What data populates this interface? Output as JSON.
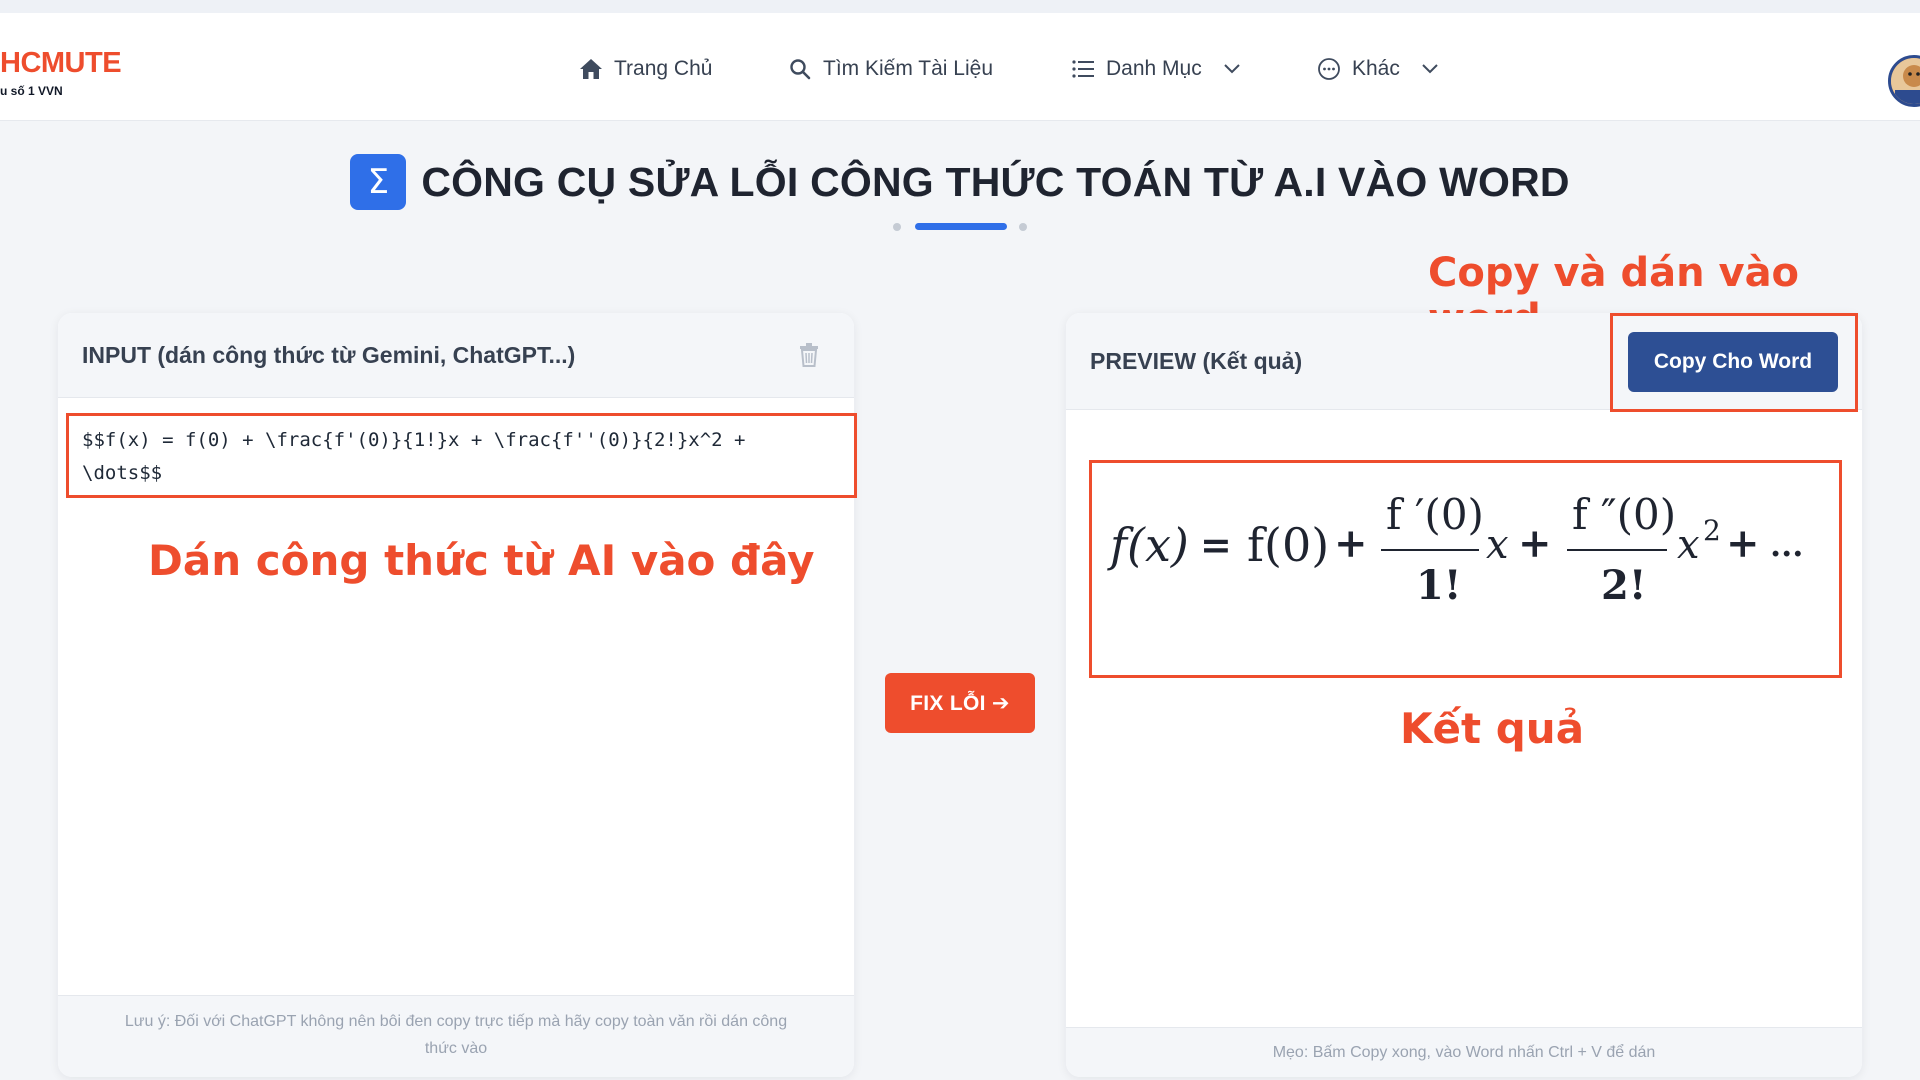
{
  "nav": {
    "logo_main": "HCMUTE",
    "logo_sub": "u số 1 VVN",
    "items": [
      {
        "label": "Trang Chủ",
        "icon": "home-icon"
      },
      {
        "label": "Tìm Kiếm Tài Liệu",
        "icon": "search-icon"
      },
      {
        "label": "Danh Mục",
        "icon": "list-icon"
      },
      {
        "label": "Khác",
        "icon": "more-icon"
      }
    ]
  },
  "page": {
    "title": "CÔNG CỤ SỬA LỖI CÔNG THỨC TOÁN TỪ A.I VÀO WORD",
    "title_icon": "Σ"
  },
  "annotations": {
    "copy_hint": "Copy và dán vào word",
    "paste_hint": "Dán công thức từ AI vào đây",
    "result_hint": "Kết quả"
  },
  "input_panel": {
    "header": "INPUT (dán công thức từ Gemini, ChatGPT...)",
    "trash_icon": "trash-icon",
    "value_line1": "$$f(x) = f(0) + \\frac{f'(0)}{1!}x + \\frac{f''(0)}{2!}x^2 +",
    "value_line2": "\\dots$$",
    "footer_line1": "Lưu ý: Đối với ChatGPT không nên bôi đen copy trực tiếp mà hãy copy toàn văn rồi dán công",
    "footer_line2": "thức vào"
  },
  "fix_button": {
    "label": "FIX LỖI ➔"
  },
  "preview_panel": {
    "header": "PREVIEW (Kết quả)",
    "copy_button": "Copy Cho Word",
    "footer": "Mẹo: Bấm Copy xong, vào Word nhấn Ctrl + V để dán"
  },
  "formula": {
    "lhs": "f(x)",
    "eq": "=",
    "f0": "f(0)",
    "plus": "+",
    "num1": "f ′(0)",
    "den1": "1!",
    "x": "x",
    "num2": "f ″(0)",
    "den2": "2!",
    "x2": "x",
    "exp2": "2",
    "dots": "..."
  },
  "colors": {
    "accent_orange": "#ee4d2d",
    "primary_blue": "#2f6fe8",
    "button_navy": "#2d4f94"
  }
}
